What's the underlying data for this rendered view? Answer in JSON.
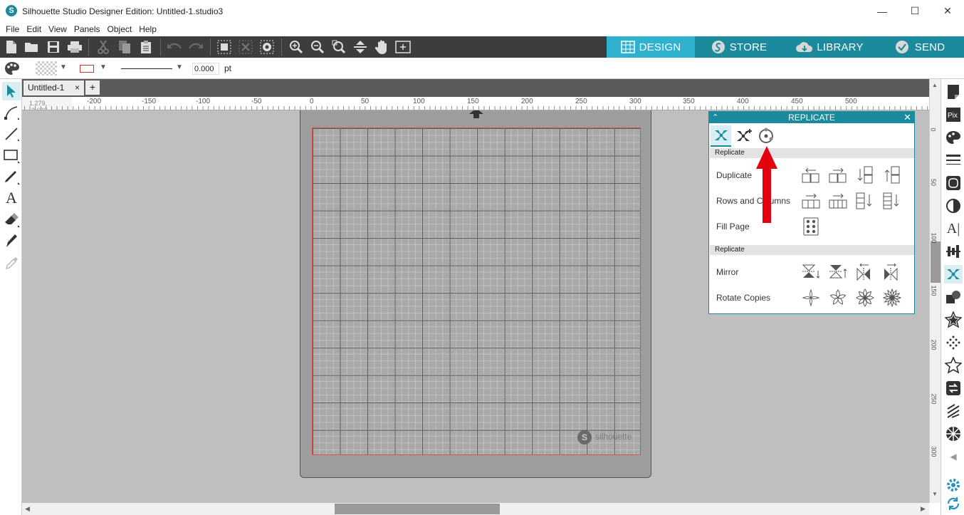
{
  "window": {
    "title": "Silhouette Studio Designer Edition: Untitled-1.studio3"
  },
  "menu": [
    "File",
    "Edit",
    "View",
    "Panels",
    "Object",
    "Help"
  ],
  "nav_tabs": [
    {
      "label": "DESIGN",
      "active": true
    },
    {
      "label": "STORE",
      "active": false
    },
    {
      "label": "LIBRARY",
      "active": false
    },
    {
      "label": "SEND",
      "active": false
    }
  ],
  "propbar": {
    "line_width_value": "0.000",
    "line_width_unit": "pt"
  },
  "document_tab": {
    "name": "Untitled-1",
    "close": "×",
    "add": "+"
  },
  "ruler": {
    "coords": "1.279, -3.693",
    "h_labels": [
      "-200",
      "-150",
      "-100",
      "-50",
      "0",
      "50",
      "100",
      "150",
      "200",
      "250",
      "300",
      "350",
      "400",
      "450",
      "500"
    ],
    "v_labels": [
      "0",
      "50",
      "100",
      "150",
      "200",
      "250",
      "300"
    ]
  },
  "mat": {
    "brand": "silhouette"
  },
  "replicate_panel": {
    "title": "REPLICATE",
    "section1": "Replicate",
    "section2": "Replicate",
    "rows": [
      "Duplicate",
      "Rows and Columns",
      "Fill Page",
      "Mirror",
      "Rotate Copies"
    ]
  },
  "colors": {
    "accent": "#1a8a9c",
    "nav_active": "#2fb2cf",
    "toolbar": "#3d3d3d",
    "arrow": "#e3000f"
  }
}
